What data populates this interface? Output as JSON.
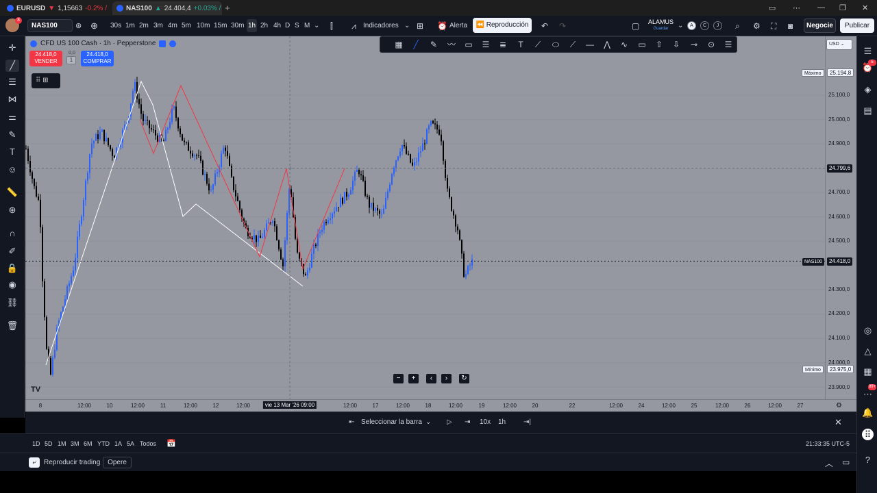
{
  "browser": {
    "tabs": [
      {
        "name": "EURUSD",
        "arrow": "▼",
        "price": "1,15663",
        "change": "-0.2% / A",
        "direction": "down"
      },
      {
        "name": "NAS100",
        "arrow": "▲",
        "price": "24.404,4",
        "change": "+0.03% /",
        "direction": "up"
      }
    ],
    "new_tab": "+"
  },
  "toolbar": {
    "avatar_badge": "3",
    "symbol": "NAS100",
    "timeframes": [
      "30s",
      "1m",
      "2m",
      "3m",
      "4m",
      "5m",
      "10m",
      "15m",
      "30m",
      "1h",
      "2h",
      "4h",
      "D",
      "S",
      "M"
    ],
    "selected_timeframe": "1h",
    "indicators_label": "Indicadores",
    "alert_label": "Alerta",
    "replay_label": "Reproducción",
    "layout_name": "ALAMUS",
    "layout_status": "Guardar",
    "layout_circles": [
      "A",
      "C",
      "J"
    ],
    "trade_label": "Negocie",
    "publish_label": "Publicar"
  },
  "chart": {
    "legend_title": "CFD US 100 Cash · 1h · Pepperstone",
    "sell_price": "24.418,0",
    "sell_label": "VENDER",
    "buy_price": "24.418,0",
    "buy_label": "COMPRAR",
    "spread_value": "0,0",
    "quantity": "1",
    "currency": "USD",
    "price_ticks": [
      "25.100,0",
      "25.000,0",
      "24.900,0",
      "24.700,0",
      "24.600,0",
      "24.500,0",
      "24.300,0",
      "24.200,0",
      "24.100,0",
      "24.000,0",
      "23.900,0"
    ],
    "max_label": "Máximo",
    "max_value": "25.194,8",
    "min_label": "Mínimo",
    "min_value": "23.975,0",
    "crosshair_price": "24.799,6",
    "current_symbol": "NAS100",
    "current_price": "24.418,0",
    "time_ticks": [
      "8",
      "12:00",
      "10",
      "12:00",
      "11",
      "12:00",
      "12",
      "12:00",
      "12:00",
      "17",
      "12:00",
      "18",
      "12:00",
      "19",
      "12:00",
      "20",
      "22",
      "12:00",
      "24",
      "12:00",
      "25",
      "12:00",
      "26",
      "12:00",
      "27"
    ],
    "crosshair_time": "vie 13 Mar '26  09:00",
    "colors": {
      "bg": "#9598a1",
      "up": "#2962ff",
      "down": "#000000",
      "zigzag_red": "#f23645",
      "zigzag_white": "#ffffff"
    }
  },
  "replay": {
    "select_bar": "Seleccionar la barra",
    "speed": "10x",
    "interval": "1h"
  },
  "ranges": {
    "items": [
      "1D",
      "5D",
      "1M",
      "3M",
      "6M",
      "YTD",
      "1A",
      "5A",
      "Todos"
    ],
    "clock": "21:33:35 UTC-5"
  },
  "bottom": {
    "replay_trading": "Reproducir trading",
    "opere": "Opere"
  },
  "rightbar": {
    "badge_1": "5",
    "badge_2": "99+"
  }
}
